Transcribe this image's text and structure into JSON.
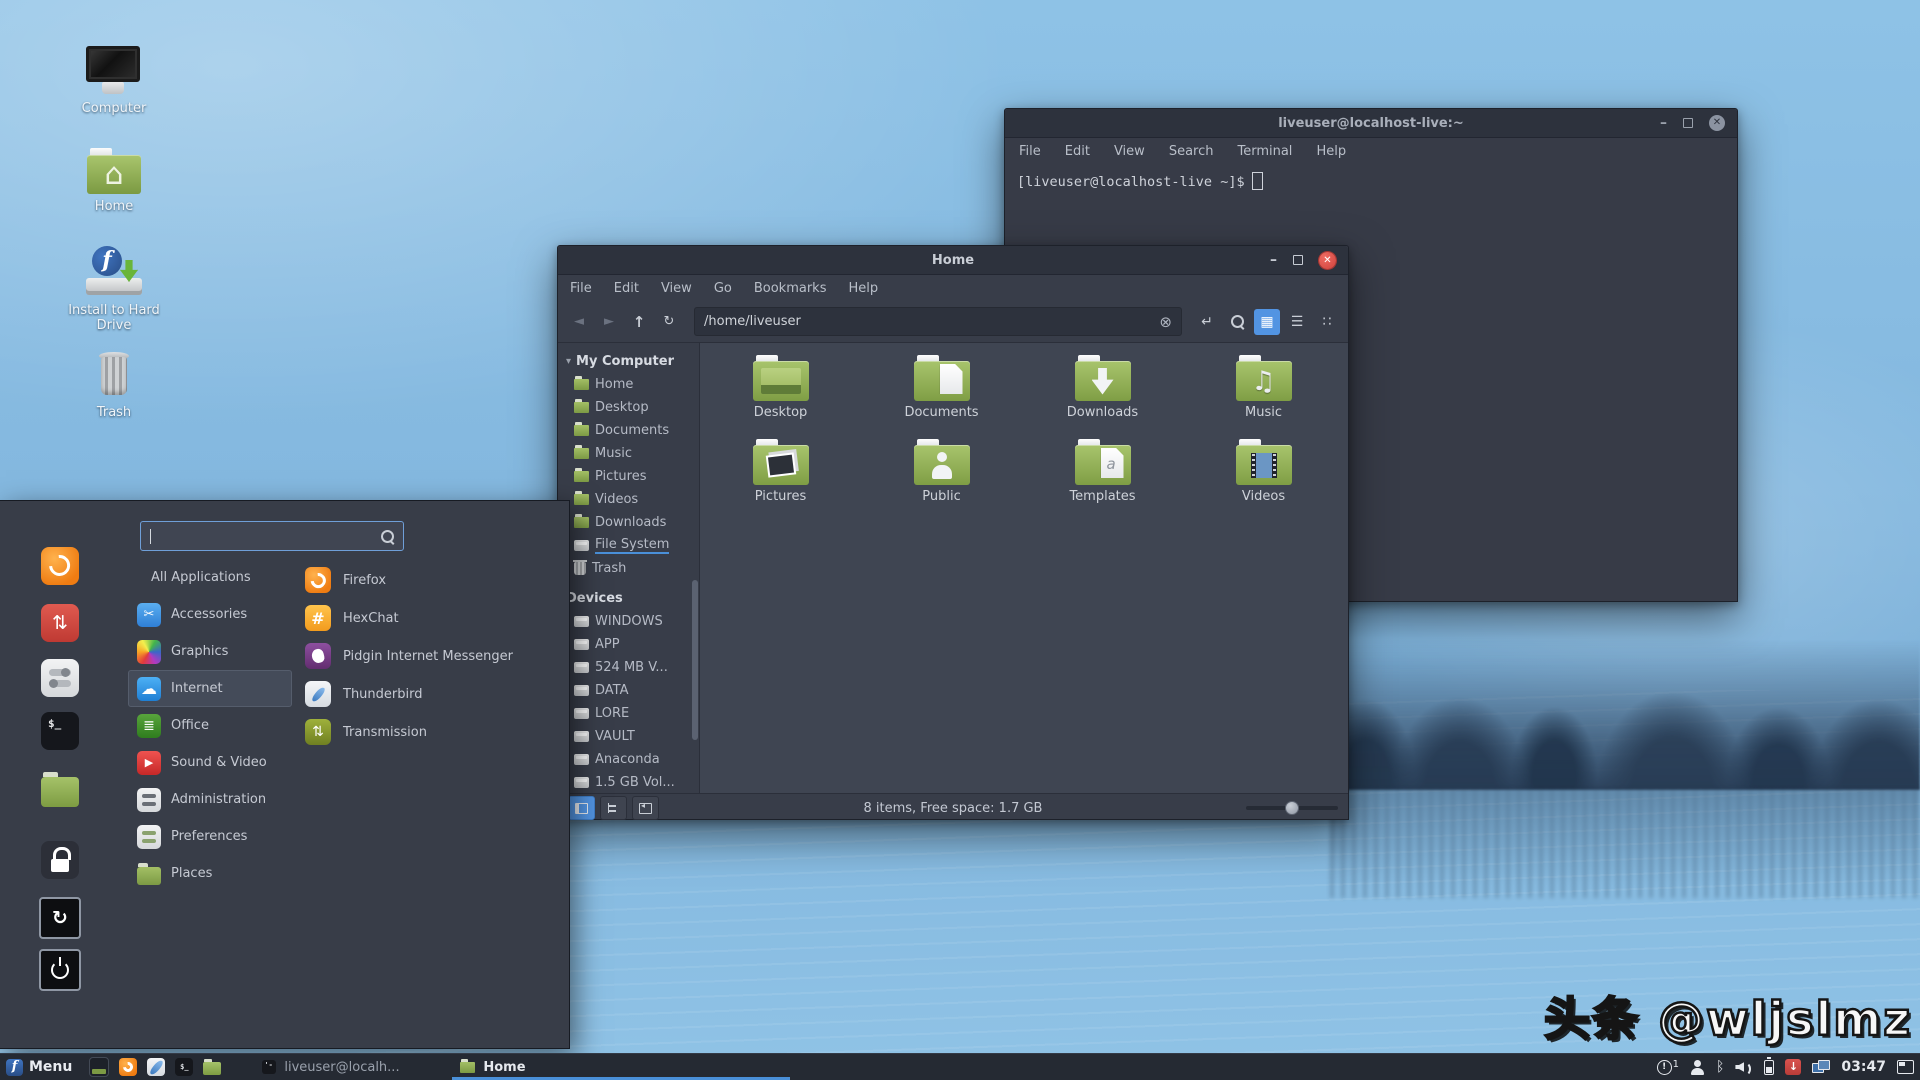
{
  "wallpaper": {
    "watermark": "头条 @wljslmz"
  },
  "desktop_icons": [
    {
      "label": "Computer",
      "icon": "computer"
    },
    {
      "label": "Home",
      "icon": "home-folder"
    },
    {
      "label": "Install to Hard Drive",
      "icon": "install-drive"
    },
    {
      "label": "Trash",
      "icon": "trash"
    }
  ],
  "terminal_window": {
    "title": "liveuser@localhost-live:~",
    "menu": [
      "File",
      "Edit",
      "View",
      "Search",
      "Terminal",
      "Help"
    ],
    "prompt": "[liveuser@localhost-live ~]$"
  },
  "file_manager": {
    "title": "Home",
    "menu": [
      "File",
      "Edit",
      "View",
      "Go",
      "Bookmarks",
      "Help"
    ],
    "path": "/home/liveuser",
    "sidebar": {
      "my_computer": {
        "header": "My Computer",
        "items": [
          {
            "label": "Home",
            "icon": "folder"
          },
          {
            "label": "Desktop",
            "icon": "folder"
          },
          {
            "label": "Documents",
            "icon": "folder"
          },
          {
            "label": "Music",
            "icon": "folder"
          },
          {
            "label": "Pictures",
            "icon": "folder"
          },
          {
            "label": "Videos",
            "icon": "folder"
          },
          {
            "label": "Downloads",
            "icon": "folder"
          },
          {
            "label": "File System",
            "icon": "drive"
          },
          {
            "label": "Trash",
            "icon": "trash"
          }
        ]
      },
      "devices": {
        "header": "Devices",
        "items": [
          {
            "label": "WINDOWS",
            "icon": "drive"
          },
          {
            "label": "APP",
            "icon": "drive"
          },
          {
            "label": "524 MB V...",
            "icon": "drive"
          },
          {
            "label": "DATA",
            "icon": "drive"
          },
          {
            "label": "LORE",
            "icon": "drive"
          },
          {
            "label": "VAULT",
            "icon": "drive"
          },
          {
            "label": "Anaconda",
            "icon": "drive"
          },
          {
            "label": "1.5 GB Vol...",
            "icon": "drive"
          }
        ]
      }
    },
    "folders": [
      {
        "label": "Desktop",
        "icon": "desktop"
      },
      {
        "label": "Documents",
        "icon": "documents"
      },
      {
        "label": "Downloads",
        "icon": "download"
      },
      {
        "label": "Music",
        "icon": "music"
      },
      {
        "label": "Pictures",
        "icon": "pictures"
      },
      {
        "label": "Public",
        "icon": "public"
      },
      {
        "label": "Templates",
        "icon": "templates"
      },
      {
        "label": "Videos",
        "icon": "videos"
      }
    ],
    "statusbar": {
      "summary": "8 items, Free space: 1.7 GB"
    }
  },
  "app_menu": {
    "search": {
      "placeholder": ""
    },
    "categories": [
      {
        "label": "All Applications",
        "icon": "none"
      },
      {
        "label": "Accessories",
        "icon": "accessories"
      },
      {
        "label": "Graphics",
        "icon": "graphics"
      },
      {
        "label": "Internet",
        "icon": "internet",
        "selected": true
      },
      {
        "label": "Office",
        "icon": "office"
      },
      {
        "label": "Sound & Video",
        "icon": "sound-video"
      },
      {
        "label": "Administration",
        "icon": "administration"
      },
      {
        "label": "Preferences",
        "icon": "preferences"
      },
      {
        "label": "Places",
        "icon": "places"
      }
    ],
    "apps": [
      {
        "label": "Firefox",
        "icon": "firefox"
      },
      {
        "label": "HexChat",
        "icon": "hexchat"
      },
      {
        "label": "Pidgin Internet Messenger",
        "icon": "pidgin"
      },
      {
        "label": "Thunderbird",
        "icon": "thunderbird"
      },
      {
        "label": "Transmission",
        "icon": "transmission"
      }
    ],
    "favorites": [
      {
        "icon": "firefox"
      },
      {
        "icon": "updater"
      },
      {
        "icon": "settings"
      },
      {
        "icon": "terminal"
      },
      {
        "icon": "files"
      },
      {
        "icon": "lock"
      },
      {
        "icon": "restart"
      },
      {
        "icon": "shutdown"
      }
    ]
  },
  "taskbar": {
    "menu_label": "Menu",
    "launchers": [
      {
        "icon": "show-desktop"
      },
      {
        "icon": "firefox"
      },
      {
        "icon": "thunderbird"
      },
      {
        "icon": "terminal"
      },
      {
        "icon": "files"
      }
    ],
    "windows": [
      {
        "label": "liveuser@localh...",
        "icon": "terminal"
      },
      {
        "label": "Home",
        "icon": "files",
        "active": true
      }
    ],
    "tray": {
      "notification_count": "1",
      "clock": "03:47"
    }
  },
  "colors": {
    "accent": "#5294e2",
    "close_button": "#d4504e",
    "folder_green": "#8fae52"
  }
}
